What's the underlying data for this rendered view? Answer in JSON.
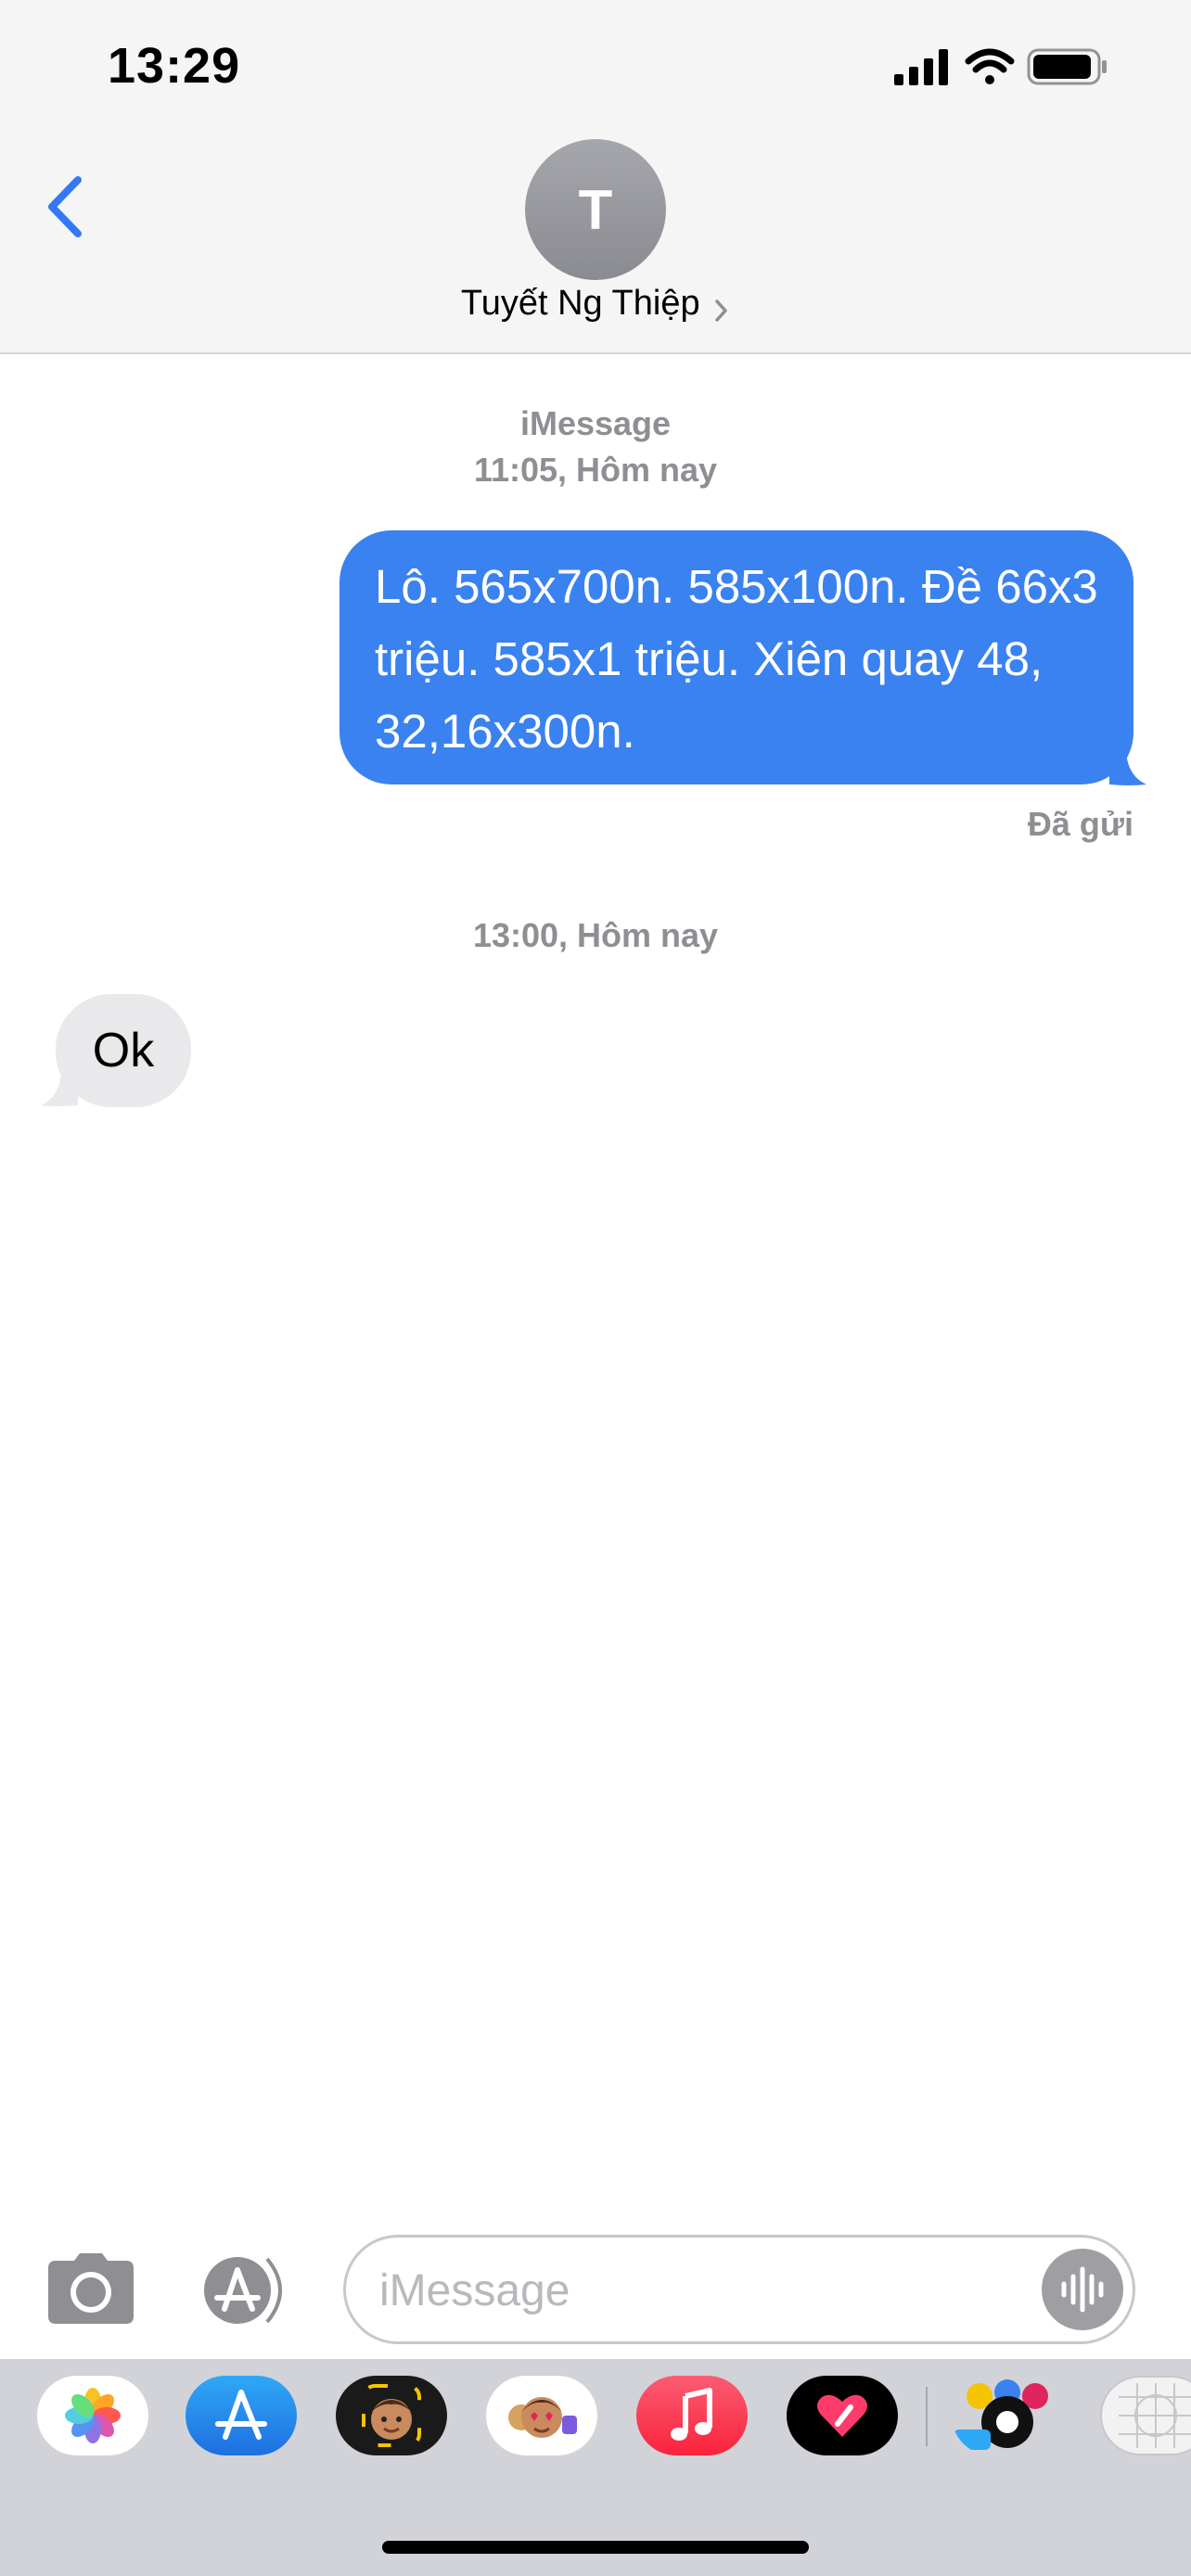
{
  "status_bar": {
    "time": "13:29",
    "icons": [
      "cellular-signal-icon",
      "wifi-icon",
      "battery-icon"
    ]
  },
  "header": {
    "back_icon": "chevron-left-icon",
    "avatar_initial": "T",
    "contact_name": "Tuyết Ng Thiệp",
    "chevron_icon": "chevron-right-icon"
  },
  "conversation": {
    "service_label": "iMessage",
    "timestamp_1": "11:05, Hôm nay",
    "outgoing_message": "Lô. 565x700n. 585x100n. Đề 66x3 triệu. 585x1 triệu. Xiên quay 48, 32,16x300n.",
    "delivery_status": "Đã gửi",
    "timestamp_2": "13:00, Hôm nay",
    "incoming_message": "Ok"
  },
  "input_bar": {
    "camera_icon": "camera-icon",
    "apps_icon": "app-store-icon",
    "placeholder": "iMessage",
    "audio_icon": "waveform-icon"
  },
  "app_drawer": {
    "apps": [
      "photos-icon",
      "app-store-icon",
      "memoji-icon",
      "memoji-stickers-icon",
      "music-icon",
      "digital-touch-icon",
      "8-ball-pool-icon",
      "more-apps-icon"
    ]
  },
  "colors": {
    "accent_blue": "#3a82f0",
    "incoming_bubble": "#e9e9eb",
    "meta_gray": "#8e8e93",
    "header_bg": "#f5f5f5",
    "drawer_bg": "#d1d3d9"
  }
}
